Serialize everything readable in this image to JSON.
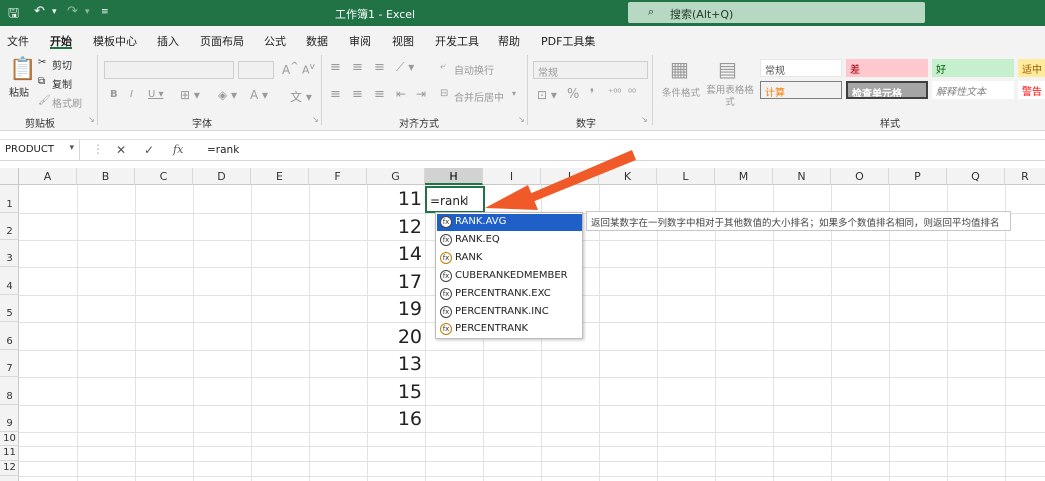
{
  "titlebar": {
    "title": "工作簿1 - Excel",
    "search_placeholder": "搜索(Alt+Q)",
    "save_icon": "save-icon",
    "undo_icon": "undo-icon",
    "redo_icon": "redo-icon",
    "customize_icon": "customize-quick-access-icon"
  },
  "menu": {
    "tabs": [
      "文件",
      "开始",
      "模板中心",
      "插入",
      "页面布局",
      "公式",
      "数据",
      "审阅",
      "视图",
      "开发工具",
      "帮助",
      "PDF工具集"
    ],
    "active": "开始"
  },
  "ribbon": {
    "clipboard": {
      "paste": "粘贴",
      "cut": "剪切",
      "copy": "复制",
      "format_painter": "格式刷",
      "group_label": "剪贴板"
    },
    "font": {
      "group_label": "字体"
    },
    "alignment": {
      "wrap_text": "自动换行",
      "merge_center": "合并后居中",
      "group_label": "对齐方式"
    },
    "number": {
      "format": "常规",
      "group_label": "数字"
    },
    "styles": {
      "conditional_format": "条件格式",
      "table_format": "套用表格格式",
      "group_label": "样式",
      "cells": [
        "常规",
        "差",
        "好",
        "适中",
        "计算",
        "检查单元格",
        "解释性文本",
        "警告"
      ]
    }
  },
  "formula_bar": {
    "name_box": "PRODUCT",
    "cancel": "✕",
    "enter": "✓",
    "fx": "fx",
    "content": "=rank"
  },
  "sheet": {
    "columns": [
      "A",
      "B",
      "C",
      "D",
      "E",
      "F",
      "G",
      "H",
      "I",
      "J",
      "K",
      "L",
      "M",
      "N",
      "O",
      "P",
      "Q",
      "R"
    ],
    "selected_column": "H",
    "rows": [
      "1",
      "2",
      "3",
      "4",
      "5",
      "6",
      "7",
      "8",
      "9",
      "10",
      "11",
      "12"
    ],
    "g_values": [
      "11",
      "12",
      "14",
      "17",
      "19",
      "20",
      "13",
      "15",
      "16"
    ],
    "active_cell_text": "=rank"
  },
  "autocomplete": {
    "items": [
      "RANK.AVG",
      "RANK.EQ",
      "RANK",
      "CUBERANKEDMEMBER",
      "PERCENTRANK.EXC",
      "PERCENTRANK.INC",
      "PERCENTRANK"
    ],
    "selected_index": 0,
    "tooltip": "返回某数字在一列数字中相对于其他数值的大小排名；如果多个数值排名相同，则返回平均值排名"
  },
  "colors": {
    "excel_green": "#217346",
    "highlight_blue": "#1e5fc8",
    "arrow_orange": "#f05a28"
  }
}
